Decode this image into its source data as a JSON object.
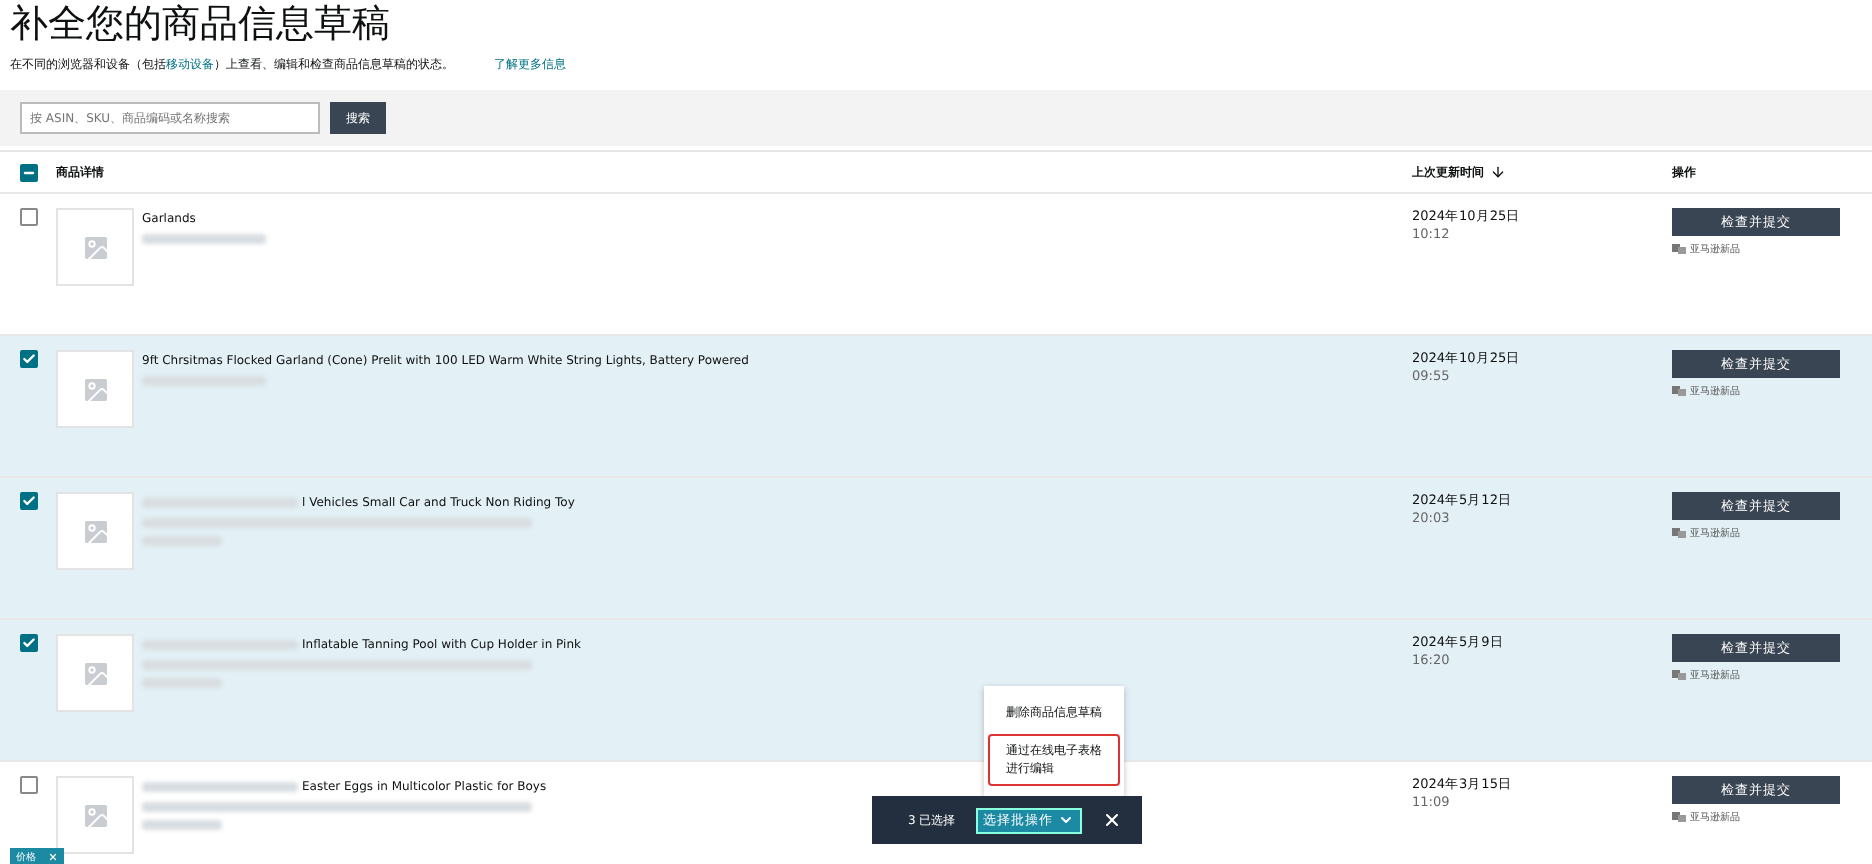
{
  "header": {
    "title": "补全您的商品信息草稿",
    "subtitle_before": "在不同的浏览器和设备（包括",
    "subtitle_link": "移动设备",
    "subtitle_after": "）上查看、编辑和检查商品信息草稿的状态。",
    "learn_more": "了解更多信息"
  },
  "search": {
    "placeholder": "按 ASIN、SKU、商品编码或名称搜索",
    "button": "搜索"
  },
  "table": {
    "select_all": {
      "indeterminate": true
    },
    "columns": [
      "商品详情",
      "上次更新时间",
      "操作"
    ],
    "rows": [
      {
        "selected": false,
        "title_redacted": false,
        "title": "Garlands",
        "kind": "one_line",
        "date": "2024年10月25日",
        "time": "10:12",
        "action": "检查并提交",
        "tag": "亚马逊新品"
      },
      {
        "selected": true,
        "title_redacted": false,
        "title": "9ft Chrsitmas Flocked Garland (Cone) Prelit with 100 LED Warm White String Lights, Battery Powered",
        "kind": "one_line",
        "date": "2024年10月25日",
        "time": "09:55",
        "action": "检查并提交",
        "tag": "亚马逊新品"
      },
      {
        "selected": true,
        "title_redacted": true,
        "title": "l Vehicles Small Car and Truck Non Riding Toy",
        "kind": "two_lines",
        "date": "2024年5月12日",
        "time": "20:03",
        "action": "检查并提交",
        "tag": "亚马逊新品"
      },
      {
        "selected": true,
        "title_redacted": true,
        "title": "Inflatable Tanning Pool with Cup Holder in Pink",
        "kind": "two_lines",
        "date": "2024年5月9日",
        "time": "16:20",
        "action": "检查并提交",
        "tag": "亚马逊新品"
      },
      {
        "selected": false,
        "title_redacted": true,
        "title": "Easter Eggs in Multicolor Plastic for Boys",
        "kind": "two_lines",
        "date": "2024年3月15日",
        "time": "11:09",
        "action": "检查并提交",
        "tag": "亚马逊新品"
      }
    ]
  },
  "bulk_bar": {
    "count": "3 已选择",
    "action": "选择批操作",
    "menu": [
      {
        "label": "删除商品信息草稿",
        "highlighted": false
      },
      {
        "label": "通过在线电子表格进行编辑",
        "highlighted": true
      }
    ]
  },
  "filter_chip": {
    "label": "价格"
  }
}
